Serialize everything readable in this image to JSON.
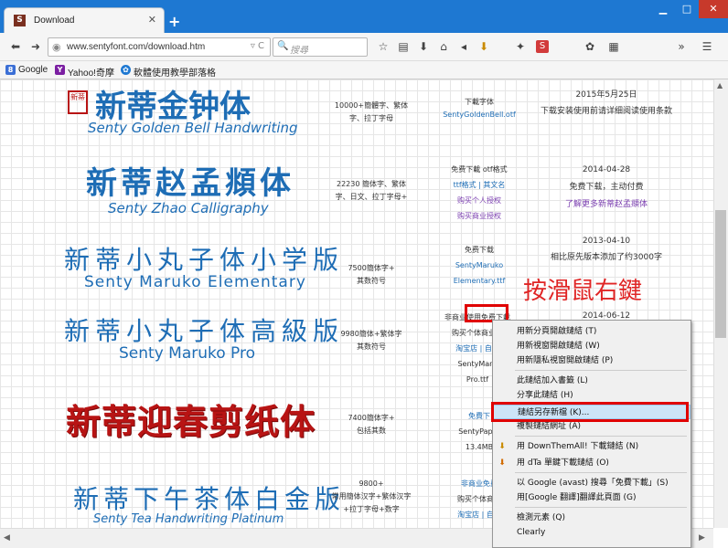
{
  "browser": {
    "tab_title": "Download",
    "tab_favicon": "S",
    "url": "www.sentyfont.com/download.htm",
    "search_placeholder": "搜尋",
    "bookmarks": [
      "Google",
      "Yahoo!奇摩",
      "軟體使用教學部落格"
    ]
  },
  "fonts": [
    {
      "title_zh": "新蒂金钟体",
      "title_en": "Senty Golden Bell Handwriting",
      "chars": [
        "10000+簡體字、繁体",
        "字、拉丁字母"
      ],
      "download": [
        "下載字体",
        "SentyGoldenBell.otf"
      ],
      "info": [
        "2015年5月25日",
        "下载安装使用前请详细阅读使用条款"
      ],
      "color": "#1e6db5"
    },
    {
      "title_zh": "新蒂赵孟頫体",
      "title_en": "Senty Zhao Calligraphy",
      "chars": [
        "22230 簡体字、繁体",
        "字、日文、拉丁字母+"
      ],
      "download": [
        "免费下載 otf格式",
        "ttf格式 | 其文名",
        "购买个人授权",
        "购买商业授权"
      ],
      "info": [
        "2014-04-28",
        "免费下载，主动付费",
        "了解更多新蒂赵孟頫体"
      ],
      "color": "#1e6db5"
    },
    {
      "title_zh": "新蒂小丸子体小学版",
      "title_en": "Senty Maruko Elementary",
      "chars": [
        "7500簡体字+",
        "其数符号"
      ],
      "download": [
        "免费下载",
        "SentyMaruko",
        "Elementary.ttf"
      ],
      "info": [
        "2013-04-10",
        "相比原先版本添加了约3000字"
      ],
      "color": "#1e6db5"
    },
    {
      "title_zh": "新蒂小丸子体高級版",
      "title_en": "Senty Maruko Pro",
      "chars": [
        "9980簡体+繁体字",
        "其数符号"
      ],
      "download": [
        "非商业使用免费下載",
        "购买个体商业授",
        "淘宝店 | 自动",
        "SentyMaru",
        "Pro.ttf"
      ],
      "info": [
        "2014-06-12"
      ],
      "color": "#1e6db5"
    },
    {
      "title_zh": "新蒂迎春剪纸体",
      "title_en": "",
      "chars": [
        "7400簡体字+",
        "包括其数"
      ],
      "download": [
        "免費下",
        "SentyPaper",
        "13.4MB"
      ],
      "info": [],
      "color": "#b81414"
    },
    {
      "title_zh": "新蒂下午茶体白金版",
      "title_en": "Senty Tea Handwriting Platinum",
      "chars": [
        "9800+",
        "常用簡体汉字+繁体汉字",
        "+拉丁字母+数字"
      ],
      "download": [
        "非商业免费",
        "购买个体商业",
        "淘宝店 | 自动"
      ],
      "info": [],
      "color": "#1e6db5"
    }
  ],
  "annotation": "按滑鼠右鍵",
  "context_menu": {
    "items": [
      "用新分頁開啟鏈結 (T)",
      "用新視窗開啟鏈結 (W)",
      "用新隱私視窗開啟鏈結 (P)",
      "此鏈結加入書籤 (L)",
      "分享此鏈結 (H)",
      "鏈結另存新檔 (K)...",
      "複製鏈結網址 (A)",
      "用 DownThemAll! 下載鏈結 (N)",
      "用 dTa 單鍵下載鏈結 (O)",
      "以 Google (avast) 搜尋「免費下載」(S)",
      "用[Google 翻譯]翻譯此頁面 (G)",
      "檢測元素 (Q)",
      "Clearly"
    ],
    "highlighted_index": 5
  },
  "colors": {
    "titlebar": "#1e78d2",
    "font_title": "#1e6db5",
    "annotation_red": "#e02525"
  }
}
